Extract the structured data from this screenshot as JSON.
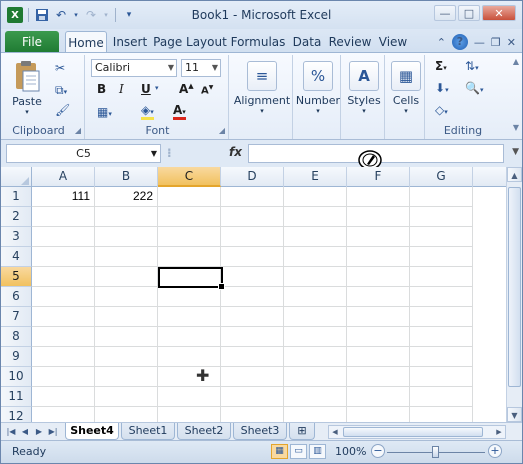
{
  "window": {
    "title": "Book1 - Microsoft Excel"
  },
  "qat": {
    "icons": [
      "excel-icon",
      "save-icon",
      "undo-icon",
      "redo-icon",
      "customize-icon"
    ]
  },
  "tabs": {
    "file": "File",
    "items": [
      {
        "label": "Home"
      },
      {
        "label": "Insert"
      },
      {
        "label": "Page Layout"
      },
      {
        "label": "Formulas"
      },
      {
        "label": "Data"
      },
      {
        "label": "Review"
      },
      {
        "label": "View"
      }
    ]
  },
  "ribbon": {
    "clipboard": {
      "label": "Clipboard",
      "paste": "Paste"
    },
    "font": {
      "label": "Font",
      "name": "Calibri",
      "size": "11",
      "bold": "B",
      "italic": "I",
      "underline": "U"
    },
    "alignment": {
      "label": "Alignment"
    },
    "number": {
      "label": "Number",
      "icon_text": "%"
    },
    "styles": {
      "label": "Styles"
    },
    "cells": {
      "label": "Cells"
    },
    "editing": {
      "label": "Editing"
    }
  },
  "formula_bar": {
    "name_box": "C5",
    "fx": "fx",
    "value": ""
  },
  "grid": {
    "columns": [
      "A",
      "B",
      "C",
      "D",
      "E",
      "F",
      "G"
    ],
    "selected_column": "C",
    "rows": [
      {
        "n": "1",
        "cells": [
          "111",
          "222",
          "",
          "",
          "",
          "",
          ""
        ]
      },
      {
        "n": "2",
        "cells": [
          "",
          "",
          "",
          "",
          "",
          "",
          ""
        ]
      },
      {
        "n": "3",
        "cells": [
          "",
          "",
          "",
          "",
          "",
          "",
          ""
        ]
      },
      {
        "n": "4",
        "cells": [
          "",
          "",
          "",
          "",
          "",
          "",
          ""
        ]
      },
      {
        "n": "5",
        "cells": [
          "",
          "",
          "",
          "",
          "",
          "",
          ""
        ]
      },
      {
        "n": "6",
        "cells": [
          "",
          "",
          "",
          "",
          "",
          "",
          ""
        ]
      },
      {
        "n": "7",
        "cells": [
          "",
          "",
          "",
          "",
          "",
          "",
          ""
        ]
      },
      {
        "n": "8",
        "cells": [
          "",
          "",
          "",
          "",
          "",
          "",
          ""
        ]
      },
      {
        "n": "9",
        "cells": [
          "",
          "",
          "",
          "",
          "",
          "",
          ""
        ]
      },
      {
        "n": "10",
        "cells": [
          "",
          "",
          "",
          "",
          "",
          "",
          ""
        ]
      },
      {
        "n": "11",
        "cells": [
          "",
          "",
          "",
          "",
          "",
          "",
          ""
        ]
      },
      {
        "n": "12",
        "cells": [
          "",
          "",
          "",
          "",
          "",
          "",
          ""
        ]
      }
    ],
    "selected_row": "5"
  },
  "sheets": {
    "tabs": [
      {
        "label": "Sheet4",
        "active": true
      },
      {
        "label": "Sheet1",
        "active": false
      },
      {
        "label": "Sheet2",
        "active": false
      },
      {
        "label": "Sheet3",
        "active": false
      }
    ]
  },
  "status": {
    "text": "Ready",
    "zoom": "100%"
  }
}
